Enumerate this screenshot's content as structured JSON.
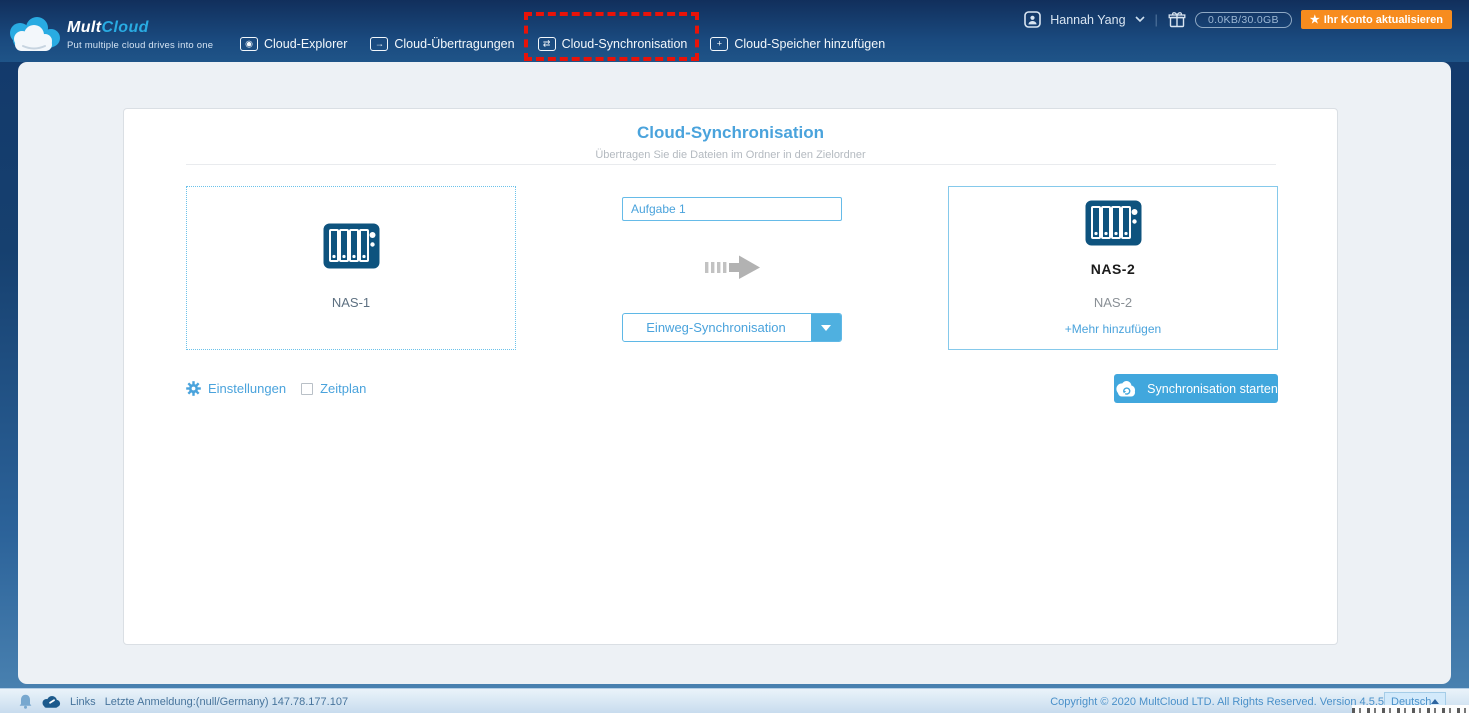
{
  "colors": {
    "accent_blue": "#4aa3dc",
    "brand_blue": "#29abe2",
    "upgrade_orange": "#f78c1e",
    "highlight_red": "#e81309",
    "nas_icon_blue": "#0e537e",
    "navbar_navy": "#143a6b"
  },
  "header": {
    "logo": {
      "brand_mult": "Mult",
      "brand_cloud": "Cloud",
      "tagline": "Put multiple cloud drives into one"
    },
    "nav": [
      {
        "label": "Cloud-Explorer",
        "glyph": "◉"
      },
      {
        "label": "Cloud-Übertragungen",
        "glyph": "→"
      },
      {
        "label": "Cloud-Synchronisation",
        "glyph": "⇄"
      },
      {
        "label": "Cloud-Speicher hinzufügen",
        "glyph": "+"
      }
    ],
    "user": {
      "name": "Hannah Yang",
      "separator": "|",
      "storage": "0.0KB/30.0GB",
      "upgrade_star": "★",
      "upgrade_label": "Ihr Konto aktualisieren"
    }
  },
  "main": {
    "title": "Cloud-Synchronisation",
    "subtitle": "Übertragen Sie die Dateien im Ordner in den Zielordner",
    "source": {
      "name": "NAS-1"
    },
    "task": {
      "value": "Aufgabe 1"
    },
    "sync_mode": {
      "selected": "Einweg-Synchronisation"
    },
    "target": {
      "name": "NAS-2",
      "account": "NAS-2",
      "add_more": "+Mehr hinzufügen"
    },
    "options": {
      "settings": "Einstellungen",
      "schedule": "Zeitplan"
    },
    "start_button": "Synchronisation starten"
  },
  "footer": {
    "links": "Links",
    "last_login": "Letzte Anmeldung:(null/Germany) 147.78.177.107",
    "copyright": "Copyright © 2020 MultCloud LTD. All Rights Reserved. Version 4.5.5",
    "language": "Deutsch"
  }
}
